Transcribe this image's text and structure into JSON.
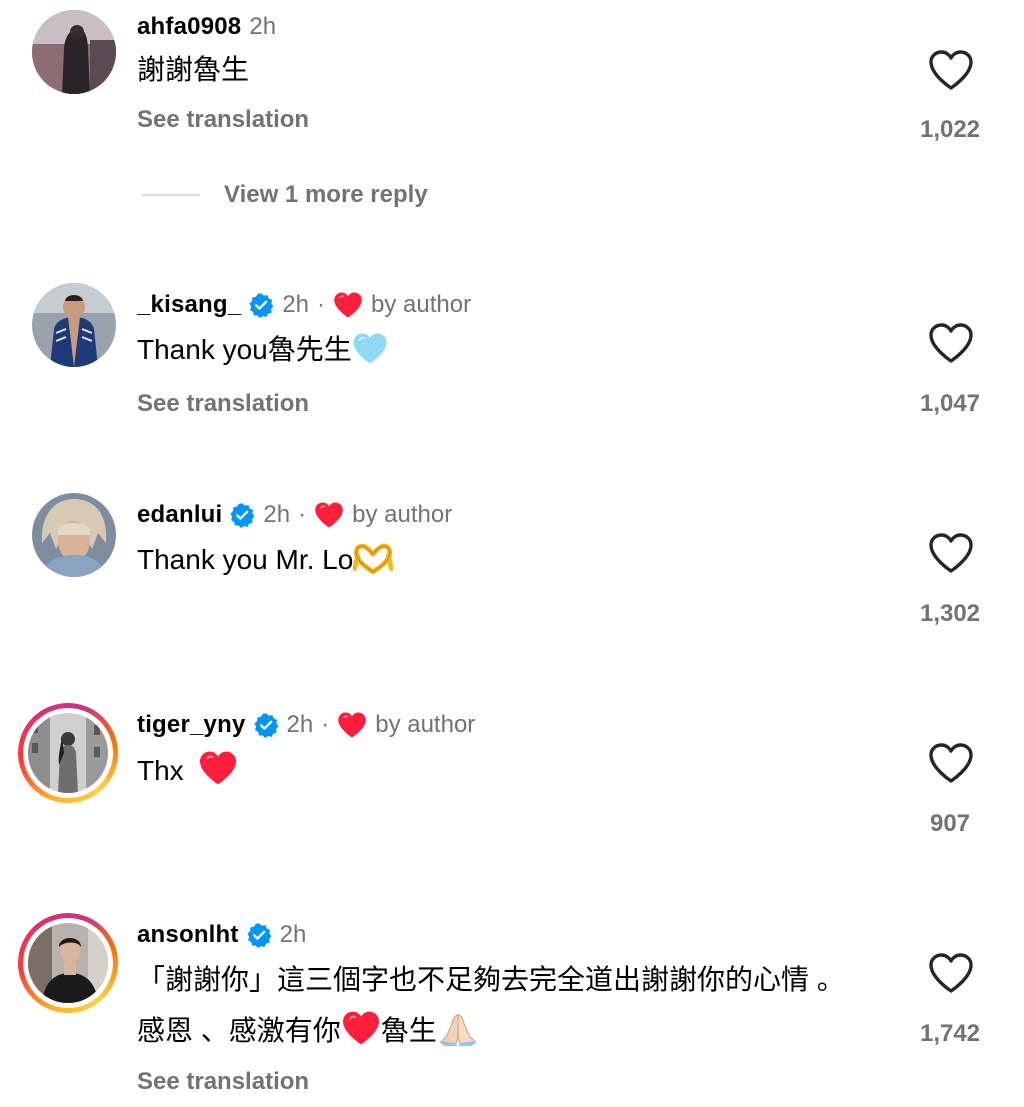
{
  "icons": {
    "like": "heart-outline-icon",
    "verified": "verified-badge-icon",
    "author_like": "red-heart-icon"
  },
  "colors": {
    "secondary_text": "#737373",
    "verified_blue": "#0095f6",
    "author_heart_red": "#ff3040"
  },
  "comments": [
    {
      "username": "ahfa0908",
      "time": "2h",
      "verified": false,
      "liked_by_author": false,
      "text": "謝謝魯生",
      "see_translation": "See translation",
      "likes": "1,022",
      "view_more_replies": "View 1 more reply"
    },
    {
      "username": "_kisang_",
      "time": "2h",
      "verified": true,
      "liked_by_author": true,
      "separator": "·",
      "by_author": "by author",
      "text": "Thank you魯先生",
      "text_emoji": "light-blue-heart-emoji",
      "see_translation": "See translation",
      "likes": "1,047"
    },
    {
      "username": "edanlui",
      "time": "2h",
      "verified": true,
      "liked_by_author": true,
      "separator": "·",
      "by_author": "by author",
      "text": "Thank you Mr. Lo",
      "text_emoji": "heart-hands-emoji",
      "likes": "1,302"
    },
    {
      "username": "tiger_yny",
      "time": "2h",
      "verified": true,
      "liked_by_author": true,
      "separator": "·",
      "by_author": "by author",
      "text": "Thx",
      "text_emoji": "red-heart-emoji",
      "likes": "907",
      "story_ring": true
    },
    {
      "username": "ansonlht",
      "time": "2h",
      "verified": true,
      "liked_by_author": false,
      "text_line1": "「謝謝你」這三個字也不足夠去完全道出謝謝你的心情 。",
      "text_line2_a": "感恩 、感激有你",
      "text_line2_b": "魯生",
      "text_emojis": [
        "red-heart-emoji",
        "folded-hands-emoji"
      ],
      "see_translation": "See translation",
      "likes": "1,742",
      "story_ring": true
    }
  ]
}
